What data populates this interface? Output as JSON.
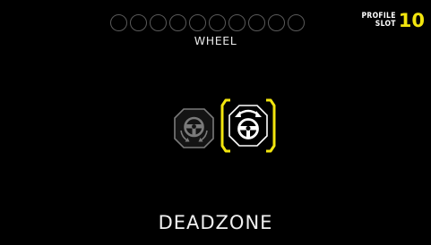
{
  "slot_dots": {
    "count": 10
  },
  "profile": {
    "label_line1": "PROFILE",
    "label_line2": "SLOT",
    "number": "10"
  },
  "mode": {
    "label": "WHEEL"
  },
  "options": [
    {
      "icon": "steering-wheel-rotation-icon",
      "selected": false
    },
    {
      "icon": "steering-wheel-deadzone-icon",
      "selected": true
    }
  ],
  "setting": {
    "title": "DEADZONE"
  },
  "colors": {
    "accent": "#f2e50e",
    "background": "#000000",
    "inactive": "#7a7a7a"
  }
}
